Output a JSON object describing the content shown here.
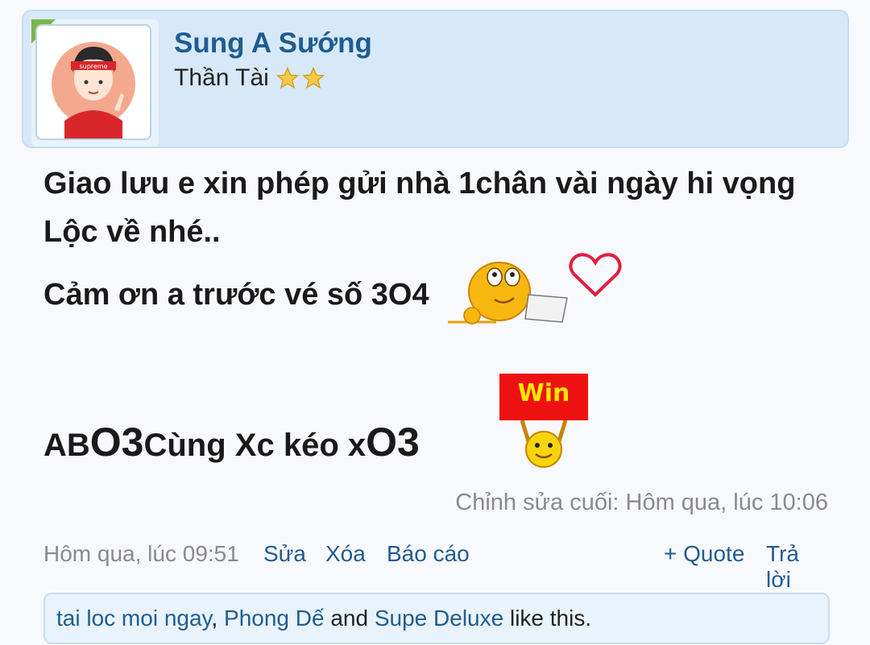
{
  "user": {
    "name": "Sung A Sướng",
    "title": "Thần Tài",
    "stars_count": 2
  },
  "post": {
    "line1": "Giao lưu e xin phép gửi nhà 1chân vài ngày hi vọng",
    "line2": "Lộc về nhé..",
    "line3": "Cảm ơn a trước vé số 3O4",
    "line4_a": "AB ",
    "line4_b": "O3",
    "line4_c": " Cùng Xc kéo x",
    "line4_d": "O3",
    "win_label": "Win"
  },
  "edited_note": "Chỉnh sửa cuối: Hôm qua, lúc 10:06",
  "meta": {
    "time": "Hôm qua, lúc 09:51",
    "edit": "Sửa",
    "delete": "Xóa",
    "report": "Báo cáo",
    "quote": "+ Quote",
    "reply": "Trả lời"
  },
  "likes": {
    "user1": "tai loc moi ngay",
    "sep1": ", ",
    "user2": "Phong Dế",
    "sep2": " and ",
    "user3": "Supe Deluxe",
    "suffix": " like this."
  },
  "colors": {
    "link": "#1f5d92",
    "card_bg": "#d7e9f8",
    "muted": "#8a8a8a",
    "win_red": "#ee1111"
  }
}
